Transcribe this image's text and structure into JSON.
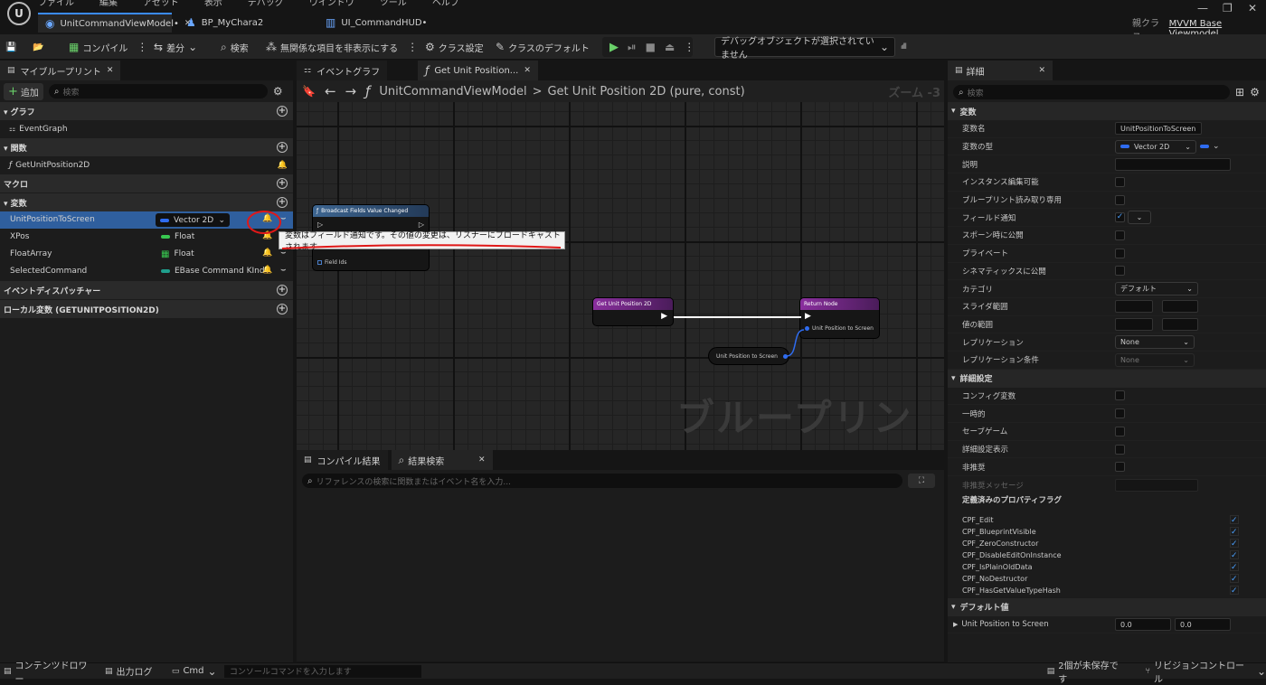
{
  "menu": [
    "ファイル",
    "編集",
    "アセット",
    "表示",
    "デバッグ",
    "ウインドウ",
    "ツール",
    "ヘルプ"
  ],
  "tabs": [
    {
      "label": "UnitCommandViewModel•"
    },
    {
      "label": "BP_MyChara2"
    },
    {
      "label": "UI_CommandHUD•"
    }
  ],
  "parent_class": {
    "prefix": "親クラス",
    "name": "MVVM Base Viewmodel"
  },
  "toolbar": {
    "compile": "コンパイル",
    "diff": "差分",
    "search": "検索",
    "hide_unrelated": "無関係な項目を非表示にする",
    "class_settings": "クラス設定",
    "class_defaults": "クラスのデフォルト",
    "debug_object": "デバッグオブジェクトが選択されていません"
  },
  "my_blueprint": {
    "tab": "マイブループリント",
    "add": "追加",
    "search_placeholder": "検索",
    "sections": {
      "graph": "グラフ",
      "functions": "関数",
      "macros": "マクロ",
      "variables": "変数",
      "dispatchers": "イベントディスパッチャー",
      "local_vars": "ローカル変数 (GETUNITPOSITION2D)"
    },
    "graph_items": [
      "EventGraph"
    ],
    "function_items": [
      "GetUnitPosition2D"
    ],
    "variables": [
      {
        "name": "UnitPositionToScreen",
        "type": "Vector 2D",
        "color": "#2f6cf0"
      },
      {
        "name": "XPos",
        "type": "Float",
        "color": "#38c750"
      },
      {
        "name": "FloatArray",
        "type": "Float",
        "color": "#38c750"
      },
      {
        "name": "SelectedCommand",
        "type": "EBase Command KInd",
        "color": "#1f9e8c"
      }
    ],
    "tooltip": "変数はフィールド通知です。その値の変更は、リスナーにブロードキャストされます"
  },
  "graph": {
    "tab1": "イベントグラフ",
    "tab2": "Get Unit Position...",
    "crumb_class": "UnitCommandViewModel",
    "crumb_sep": ">",
    "crumb_func": "Get Unit Position 2D (pure, const)",
    "zoom": "ズーム -3",
    "watermark": "ブループリント",
    "nodes": {
      "broadcast": "Broadcast Fields Value Changed",
      "broadcast_pin": "Field Ids",
      "entry": "Get Unit Position 2D",
      "ret": "Return Node",
      "ret_pin": "Unit Position to Screen",
      "getter": "Unit Position to Screen"
    }
  },
  "bottom": {
    "tab1": "コンパイル結果",
    "tab2": "結果検索",
    "search_placeholder": "リファレンスの検索に関数またはイベント名を入力..."
  },
  "details": {
    "tab": "詳細",
    "search_placeholder": "検索",
    "sec_var": "変数",
    "rows": [
      {
        "label": "変数名",
        "kind": "field",
        "value": "UnitPositionToScreen"
      },
      {
        "label": "変数の型",
        "kind": "type",
        "value": "Vector 2D"
      },
      {
        "label": "説明",
        "kind": "field",
        "value": ""
      },
      {
        "label": "インスタンス編集可能",
        "kind": "check"
      },
      {
        "label": "ブループリント読み取り専用",
        "kind": "check"
      },
      {
        "label": "フィールド通知",
        "kind": "check_on"
      },
      {
        "label": "スポーン時に公開",
        "kind": "check"
      },
      {
        "label": "プライベート",
        "kind": "check"
      },
      {
        "label": "シネマティックスに公開",
        "kind": "check"
      },
      {
        "label": "カテゴリ",
        "kind": "drop",
        "value": "デフォルト"
      },
      {
        "label": "スライダ範囲",
        "kind": "two"
      },
      {
        "label": "値の範囲",
        "kind": "two"
      },
      {
        "label": "レプリケーション",
        "kind": "drop2",
        "value": "None"
      },
      {
        "label": "レプリケーション条件",
        "kind": "drop3",
        "value": "None"
      }
    ],
    "sec_adv": "詳細設定",
    "adv_rows": [
      "コンフィグ変数",
      "一時的",
      "セーブゲーム",
      "詳細設定表示",
      "非推奨"
    ],
    "deprecated_msg": "非推奨メッセージ",
    "flags_title": "定義済みのプロパティフラグ",
    "flags": [
      "CPF_Edit",
      "CPF_BlueprintVisible",
      "CPF_ZeroConstructor",
      "CPF_DisableEditOnInstance",
      "CPF_IsPlainOldData",
      "CPF_NoDestructor",
      "CPF_HasGetValueTypeHash"
    ],
    "sec_default": "デフォルト値",
    "default_label": "Unit Position to Screen",
    "default_x": "0.0",
    "default_y": "0.0"
  },
  "status": {
    "content_drawer": "コンテンツドロワー",
    "output_log": "出力ログ",
    "cmd": "Cmd",
    "console_placeholder": "コンソールコマンドを入力します",
    "unsaved": "2個が未保存です",
    "revision": "リビジョンコントロール"
  }
}
